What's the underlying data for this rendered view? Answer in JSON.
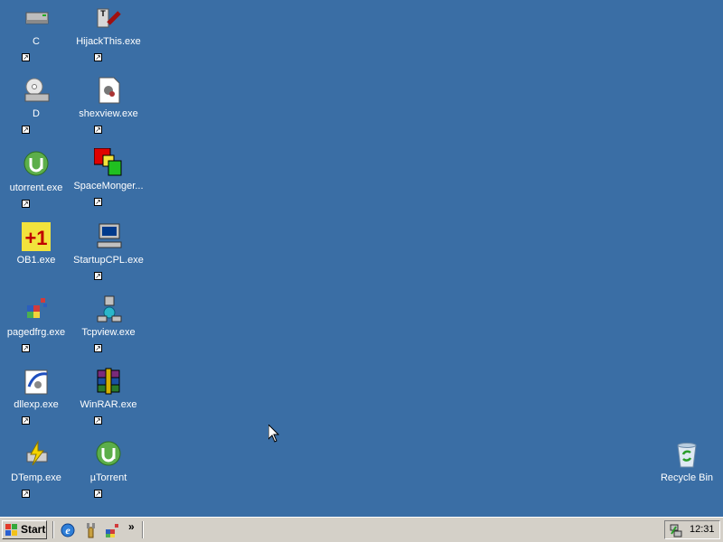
{
  "desktop": {
    "icons": [
      {
        "label": "C"
      },
      {
        "label": "HijackThis.exe"
      },
      {
        "label": "D"
      },
      {
        "label": "shexview.exe"
      },
      {
        "label": "utorrent.exe"
      },
      {
        "label": "SpaceMonger..."
      },
      {
        "label": "OB1.exe"
      },
      {
        "label": "StartupCPL.exe"
      },
      {
        "label": "pagedfrg.exe"
      },
      {
        "label": "Tcpview.exe"
      },
      {
        "label": "dllexp.exe"
      },
      {
        "label": "WinRAR.exe"
      },
      {
        "label": "DTemp.exe"
      },
      {
        "label": "µTorrent"
      },
      {
        "label": "Recycle Bin"
      }
    ]
  },
  "taskbar": {
    "start_label": "Start",
    "chevron": "»",
    "clock": "12:31"
  },
  "colors": {
    "desktop": "#3a6ea5",
    "taskbar": "#d4d0c8"
  }
}
